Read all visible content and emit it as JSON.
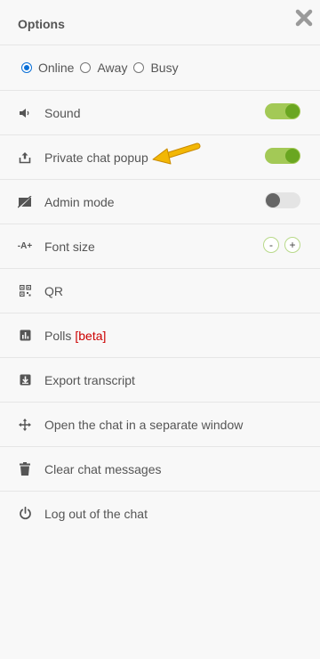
{
  "header": {
    "title": "Options"
  },
  "status": {
    "selected": "online",
    "options": [
      {
        "key": "online",
        "label": "Online"
      },
      {
        "key": "away",
        "label": "Away"
      },
      {
        "key": "busy",
        "label": "Busy"
      }
    ]
  },
  "items": [
    {
      "label": "Sound",
      "icon": "speaker-icon",
      "control": "toggle",
      "on": true
    },
    {
      "label": "Private chat popup",
      "icon": "upload-icon",
      "control": "toggle",
      "on": true
    },
    {
      "label": "Admin mode",
      "icon": "admin-mode-icon",
      "control": "toggle",
      "on": false
    },
    {
      "label": "Font size",
      "icon": "font-size-icon",
      "control": "stepper",
      "icon_text": "-A+",
      "minus": "-",
      "plus": "+"
    },
    {
      "label": "QR",
      "icon": "qr-code-icon"
    },
    {
      "label": "Polls",
      "icon": "bar-chart-icon",
      "tag": "[beta]"
    },
    {
      "label": "Export transcript",
      "icon": "download-icon"
    },
    {
      "label": "Open the chat in a separate window",
      "icon": "move-arrows-icon"
    },
    {
      "label": "Clear chat messages",
      "icon": "trash-icon"
    },
    {
      "label": "Log out of the chat",
      "icon": "power-icon"
    }
  ],
  "colors": {
    "toggle_on_track": "#a3c956",
    "toggle_on_knob": "#6aa621",
    "toggle_off_track": "#e4e4e4",
    "toggle_off_knob": "#666666",
    "radio_accent": "#0a6fd6",
    "beta_tag": "#cc0000",
    "annotation_arrow": "#f2b705"
  }
}
